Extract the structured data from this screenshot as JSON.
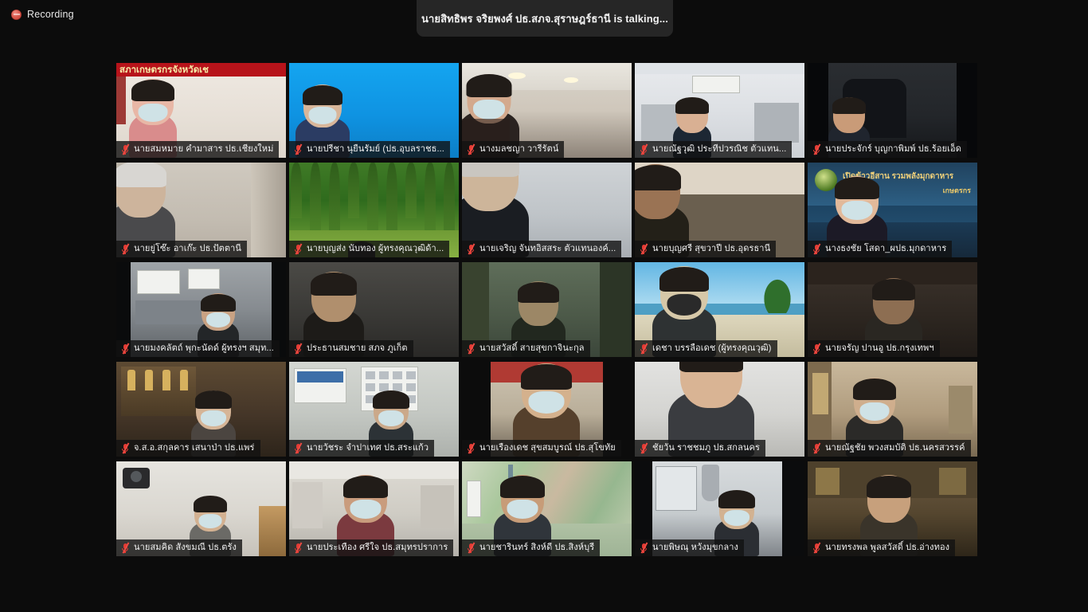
{
  "window": {
    "app": "video-conference",
    "background_color": "#0c0c0c"
  },
  "topbar": {
    "recording_label": "Recording",
    "recording_icon": "recording-dot-icon",
    "active_speaker_banner": "นายสิทธิพร จริยพงศ์ ปธ.สภจ.สุราษฎร์ธานี is  talking...",
    "pill_color": "#262626"
  },
  "gallery": {
    "columns": 5,
    "rows": 5,
    "mute_icon": "microphone-muted-icon",
    "tiles": [
      {
        "name": "นายสมหมาย  คำมาสาร ปธ.เชียงใหม่",
        "muted": true,
        "scene": "sc-office-pink",
        "banner_text": "สภาเกษตรกรจังหวัดเช",
        "banner_color": "#b7131a"
      },
      {
        "name": "นายปรีชา นุยืนรัมย์ (ปธ.อุบลราชธ...",
        "muted": true,
        "scene": "sc-blue"
      },
      {
        "name": "นางมลชญา วารีรัตน์",
        "muted": true,
        "scene": "sc-room-warm"
      },
      {
        "name": "นายณัฐวุฒิ  ประทีปวรณิช  ตัวแทน...",
        "muted": true,
        "scene": "sc-office-white"
      },
      {
        "name": "นายประจักร์ บุญกาพิมพ์ ปธ.ร้อยเอ็ด",
        "muted": true,
        "scene": "sc-dark-office"
      },
      {
        "name": "นายยู่โซ๊ะ  อาเก๊ะ ปธ.ปัตตานี",
        "muted": true,
        "scene": "sc-curtain"
      },
      {
        "name": "นายบุญส่ง นับทอง ผู้ทรงคุณวุฒิด้า...",
        "muted": true,
        "scene": "sc-plantation"
      },
      {
        "name": "นายเจริญ  จันทอิสสระ ตัวแทนองค์...",
        "muted": true,
        "scene": "sc-grey-room"
      },
      {
        "name": "นายบุญศรี สุขวาปี ปธ.อุดรธานี",
        "muted": true,
        "scene": "sc-beige-room"
      },
      {
        "name": "นางธงชัย โสดา_ผปธ.มุกดาหาร",
        "muted": true,
        "scene": "sc-mukdahan",
        "banner_text": "เปิดข้าวอีสาน รวมพลังมุกดาหาร",
        "banner_text2": "เกษตรกร"
      },
      {
        "name": "นายมงคลัตถ์ พุกะนัดด์ ผู้ทรงฯ สมุท...",
        "muted": true,
        "scene": "sc-officecam"
      },
      {
        "name": "ประธานสมชาย สภจ ภูเก็ต",
        "muted": true,
        "scene": "sc-dim-room"
      },
      {
        "name": "นายสวัสดิ์ สายสุขกาจินะกุล",
        "muted": true,
        "scene": "sc-green-wall"
      },
      {
        "name": "เดชา บรรลือเดช (ผู้ทรงคุณวุฒิ)",
        "muted": true,
        "scene": "sc-beach"
      },
      {
        "name": "นายจรัญ ปานอู ปธ.กรุงเทพฯ",
        "muted": true,
        "scene": "sc-dark-wood"
      },
      {
        "name": "จ.ส.อ.สกุลคาร เสนาป่า ปธ.แพร่",
        "muted": true,
        "scene": "sc-altar"
      },
      {
        "name": "นายวัชระ จำปาเทศ ปธ.สระแก้ว",
        "muted": true,
        "scene": "sc-classroom"
      },
      {
        "name": "นายเรืองเดช สุขสมบูรณ์ ปธ.สุโขทัย",
        "muted": true,
        "scene": "sc-elder-room"
      },
      {
        "name": "ชัยวัน ราชชมภู ปธ.สกลนคร",
        "muted": true,
        "scene": "sc-white-wall"
      },
      {
        "name": "นายณัฐชัย พวงสมบัติ ปธ.นครสวรรค์",
        "muted": true,
        "scene": "sc-nakhon"
      },
      {
        "name": "นายสมคิด สังขมณี ปธ.ตรัง",
        "muted": true,
        "scene": "sc-trang"
      },
      {
        "name": "นายประเทือง ศรีใจ ปธ.สมุทรปราการ",
        "muted": true,
        "scene": "sc-samut"
      },
      {
        "name": "นายชารินทร์ สิงห์ดี ปธ.สิงห์บุรี",
        "muted": true,
        "scene": "sc-map"
      },
      {
        "name": "นายพิษณุ หวังมุขกลาง",
        "muted": true,
        "scene": "sc-window"
      },
      {
        "name": "นายทรงพล พูลสวัสดิ์ ปธ.อ่างทอง",
        "muted": true,
        "scene": "sc-angthong"
      }
    ]
  }
}
